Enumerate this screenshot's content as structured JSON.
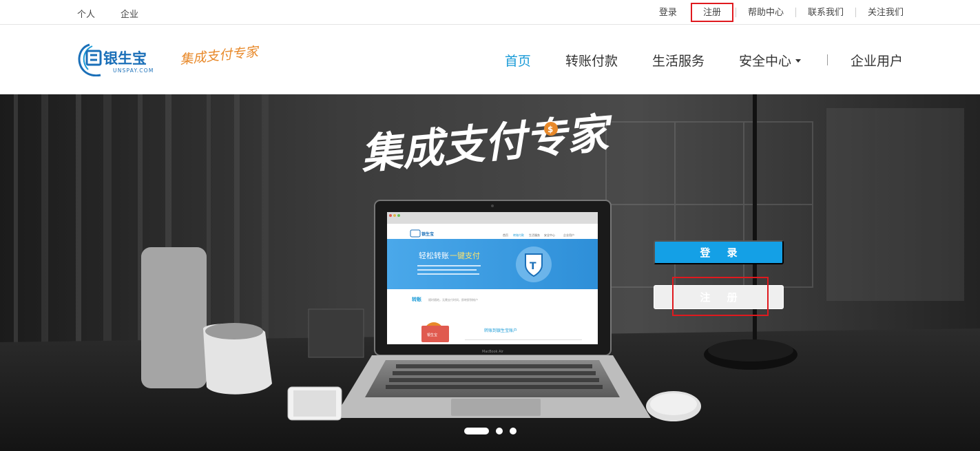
{
  "topbar": {
    "left_links": [
      "个人",
      "企业"
    ],
    "login": "登录",
    "register": "注册",
    "help": "帮助中心",
    "contact": "联系我们",
    "follow": "关注我们"
  },
  "header": {
    "logo_text": "银生宝",
    "logo_sub": "UNSPAY.COM",
    "slogan": "集成支付专家",
    "nav": {
      "home": "首页",
      "transfer": "转账付款",
      "life": "生活服务",
      "security": "安全中心",
      "enterprise": "企业用户"
    }
  },
  "banner": {
    "headline": "集成支付专家",
    "login_button": "登 录",
    "register_button": "注 册",
    "screen": {
      "logo": "银生宝",
      "nav": [
        "首页",
        "转账付款",
        "生活服务",
        "安全中心",
        "企业用户"
      ],
      "hero_title": "轻松转账",
      "hero_title_accent": "一键支付",
      "section_title": "转账",
      "section_desc": "随时随地，无需支付时间，即转即到帐户",
      "sub_link": "转账到银生宝账户",
      "laptop_brand": "MacBook Air"
    },
    "slides": 3,
    "active_slide": 0
  },
  "colors": {
    "accent": "#1a9bd7",
    "login_button": "#14a0e6",
    "highlight": "#e0191e"
  }
}
